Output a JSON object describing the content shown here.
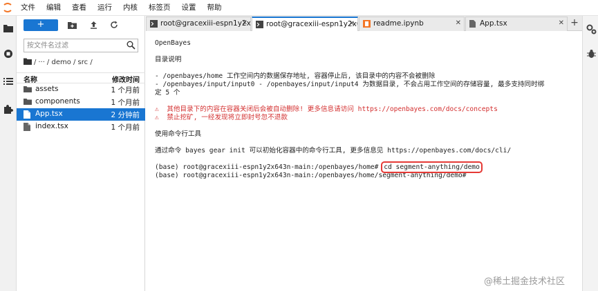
{
  "menubar": {
    "items": [
      "文件",
      "编辑",
      "查看",
      "运行",
      "内核",
      "标签页",
      "设置",
      "帮助"
    ]
  },
  "filebrowser": {
    "new_label": "+",
    "filter_placeholder": "按文件名过滤",
    "breadcrumb": [
      "/",
      "···",
      "/ demo / src /"
    ],
    "columns": {
      "name": "名称",
      "modified": "修改时间"
    },
    "files": [
      {
        "name": "assets",
        "type": "folder",
        "modified": "1 个月前"
      },
      {
        "name": "components",
        "type": "folder",
        "modified": "1 个月前"
      },
      {
        "name": "App.tsx",
        "type": "tsx",
        "modified": "2 分钟前",
        "selected": true
      },
      {
        "name": "index.tsx",
        "type": "tsx",
        "modified": "1 个月前"
      }
    ]
  },
  "tabs": [
    {
      "label": "root@gracexiii-espn1y2x6",
      "icon": "terminal-icon",
      "active": false
    },
    {
      "label": "root@gracexiii-espn1y2x6",
      "icon": "terminal-icon",
      "active": true
    },
    {
      "label": "readme.ipynb",
      "icon": "notebook-icon",
      "active": false
    },
    {
      "label": "App.tsx",
      "icon": "file-icon",
      "active": false
    }
  ],
  "terminal": {
    "lines": [
      {
        "text": "OpenBayes",
        "color": "normal"
      },
      {
        "text": "",
        "color": "normal"
      },
      {
        "text": "目录说明",
        "color": "normal"
      },
      {
        "text": "",
        "color": "normal"
      },
      {
        "text": "- /openbayes/home 工作空间内的数据保存地址, 容器停止后, 该目录中的内容不会被删除",
        "color": "normal"
      },
      {
        "text": "- /openbayes/input/input0 - /openbayes/input/input4 为数据目录, 不会占用工作空间的存储容量, 最多支持同时绑",
        "color": "normal"
      },
      {
        "text": "定 5 个",
        "color": "normal"
      },
      {
        "text": "",
        "color": "normal"
      },
      {
        "text": "⚠  其他目录下的内容在容器关闭后会被自动删除! 更多信息请访问 https://openbayes.com/docs/concepts",
        "color": "red"
      },
      {
        "text": "⚠  禁止挖矿, 一经发现将立即封号忽不退款",
        "color": "red"
      },
      {
        "text": "",
        "color": "normal"
      },
      {
        "text": "使用命令行工具",
        "color": "normal"
      },
      {
        "text": "",
        "color": "normal"
      },
      {
        "text": "通过命令 bayes gear init 可以初始化容器中的命令行工具, 更多信息见 https://openbayes.com/docs/cli/",
        "color": "normal"
      },
      {
        "text": "",
        "color": "normal"
      }
    ],
    "prompt1": "(base) root@gracexiii-espn1y2x643n-main:/openbayes/home# ",
    "command1": "cd segment-anything/demo",
    "prompt2": "(base) root@gracexiii-espn1y2x643n-main:/openbayes/home/segment-anything/demo# "
  },
  "watermark": "@稀土掘金技术社区",
  "colors": {
    "accent": "#1976d2",
    "warning": "#d32f2f",
    "highlight_box": "#e53935"
  }
}
